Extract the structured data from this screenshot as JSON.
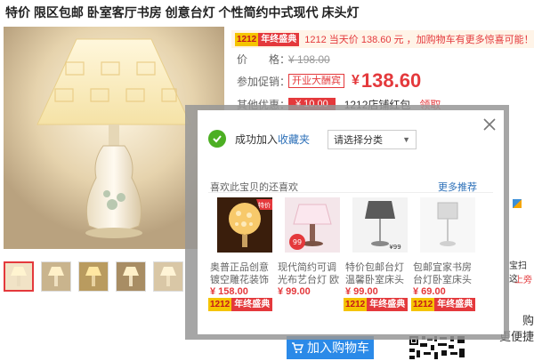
{
  "title": "特价 限区包邮 卧室客厅书房 创意台灯 个性简约中式现代 床头灯",
  "promo": {
    "badge_num": "1212",
    "badge_text": "年终盛典",
    "text": "1212 当天价 138.60 元 ，加购物车有更多惊喜可能！"
  },
  "price": {
    "label": "价　　格：",
    "currency": "¥",
    "original": "198.00"
  },
  "promotion": {
    "label": "参加促销：",
    "tag": "开业大酬宾",
    "currency": "¥",
    "value": "138.60"
  },
  "other": {
    "label": "其他优惠：",
    "coupon": "¥ 10.00",
    "coupon_text": "1212店铺红包",
    "claim": "领取"
  },
  "cart_button": "加入购物车",
  "right_side": {
    "line1": "购",
    "line2": "更便捷",
    "edge1": "宝扫这",
    "edge2": "上旁"
  },
  "modal": {
    "success_text": "成功加入",
    "favorites_link": "收藏夹",
    "select_placeholder": "请选择分类",
    "rec_title": "喜欢此宝贝的还喜欢",
    "more": "更多推荐",
    "items": [
      {
        "name": "奥普正品创意镀空雕花装饰",
        "price": "¥ 158.00",
        "badge_num": "1212",
        "badge_text": "年终盛典"
      },
      {
        "name": "现代简约可调光布艺台灯 欧",
        "price": "¥ 99.00",
        "badge_num": "",
        "badge_text": ""
      },
      {
        "name": "特价包邮台灯温馨卧室床头",
        "price": "¥ 99.00",
        "badge_num": "1212",
        "badge_text": "年终盛典"
      },
      {
        "name": "包邮宜家书房台灯卧室床头",
        "price": "¥ 69.00",
        "badge_num": "1212",
        "badge_text": "年终盛典"
      }
    ],
    "item_overlays": {
      "tag_hot": "特价",
      "tag_99": "99",
      "tag_99_2": "¥99"
    }
  },
  "colors": {
    "accent_red": "#e4393c",
    "link_blue": "#2b6fb8",
    "cart_blue": "#2b8ae8",
    "success_green": "#4caf23",
    "badge_yellow": "#f5c400"
  }
}
